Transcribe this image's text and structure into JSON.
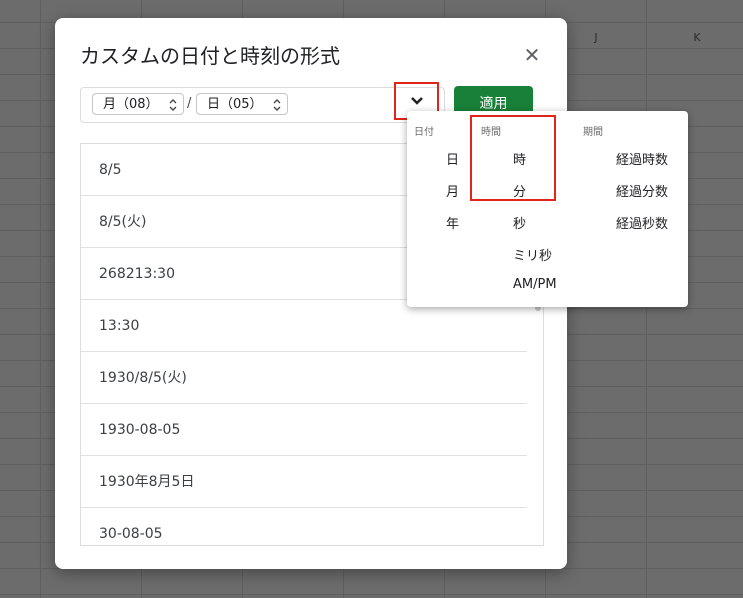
{
  "sheet": {
    "columns": [
      "J",
      "K"
    ]
  },
  "dialog": {
    "title": "カスタムの日付と時刻の形式",
    "close_icon": "close-icon",
    "format_bar": {
      "chip1": "月（08）",
      "separator": "/",
      "chip2": "日（05）"
    },
    "apply_label": "適用",
    "list": [
      "8/5",
      "8/5(火)",
      "268213:30",
      "13:30",
      "1930/8/5(火)",
      "1930-08-05",
      "1930年8月5日",
      "30-08-05"
    ]
  },
  "popup": {
    "headers": {
      "date": "日付",
      "time": "時間",
      "period": "期間"
    },
    "date_items": [
      "日",
      "月",
      "年"
    ],
    "time_items": [
      "時",
      "分",
      "秒",
      "ミリ秒",
      "AM/PM"
    ],
    "period_items": [
      "経過時数",
      "経過分数",
      "経過秒数"
    ]
  },
  "colors": {
    "apply_green": "#188038",
    "highlight_red": "#e1251b"
  }
}
